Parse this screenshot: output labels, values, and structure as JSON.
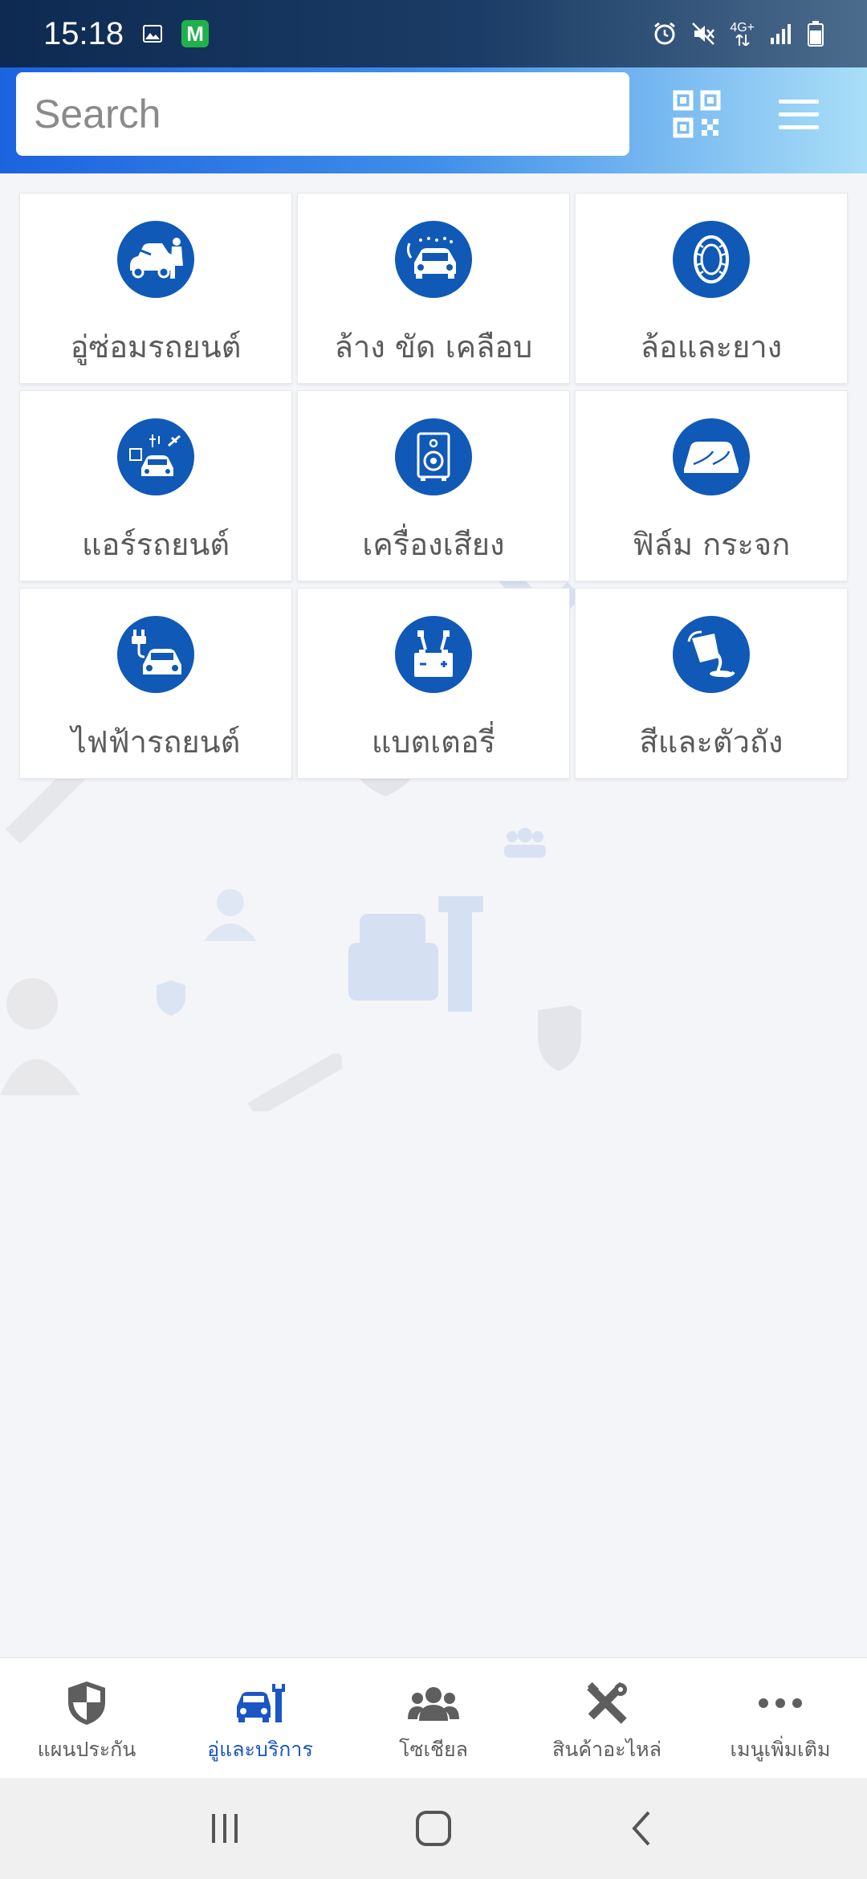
{
  "status_bar": {
    "time": "15:18",
    "network": "4G+",
    "icons": [
      "gallery-icon",
      "m-app-icon",
      "alarm-icon",
      "mute-icon",
      "signal-icon",
      "battery-icon"
    ],
    "m_label": "M"
  },
  "header": {
    "search_placeholder": "Search",
    "icons": [
      "qr-code-icon",
      "hamburger-menu-icon"
    ]
  },
  "services": [
    {
      "label": "อู่ซ่อมรถยนต์",
      "icon": "car-repair-icon"
    },
    {
      "label": "ล้าง ขัด เคลือบ",
      "icon": "car-wash-icon"
    },
    {
      "label": "ล้อและยาง",
      "icon": "tire-icon"
    },
    {
      "label": "แอร์รถยนต์",
      "icon": "car-aircon-icon"
    },
    {
      "label": "เครื่องเสียง",
      "icon": "speaker-icon"
    },
    {
      "label": "ฟิล์ม กระจก",
      "icon": "windshield-icon"
    },
    {
      "label": "ไฟฟ้ารถยนต์",
      "icon": "car-electric-icon"
    },
    {
      "label": "แบตเตอรี่",
      "icon": "battery-charge-icon"
    },
    {
      "label": "สีและตัวถัง",
      "icon": "paint-bucket-icon"
    }
  ],
  "bottom_nav": [
    {
      "label": "แผนประกัน",
      "icon": "shield-icon",
      "active": false
    },
    {
      "label": "อู่และบริการ",
      "icon": "car-wrench-icon",
      "active": true
    },
    {
      "label": "โซเชียล",
      "icon": "users-icon",
      "active": false
    },
    {
      "label": "สินค้าอะไหล่",
      "icon": "tools-icon",
      "active": false
    },
    {
      "label": "เมนูเพิ่มเติม",
      "icon": "more-dots-icon",
      "active": false
    }
  ],
  "colors": {
    "accent": "#1059b6",
    "active_nav": "#1a56c4",
    "header_start": "#1c63e0",
    "header_end": "#a9def7"
  }
}
